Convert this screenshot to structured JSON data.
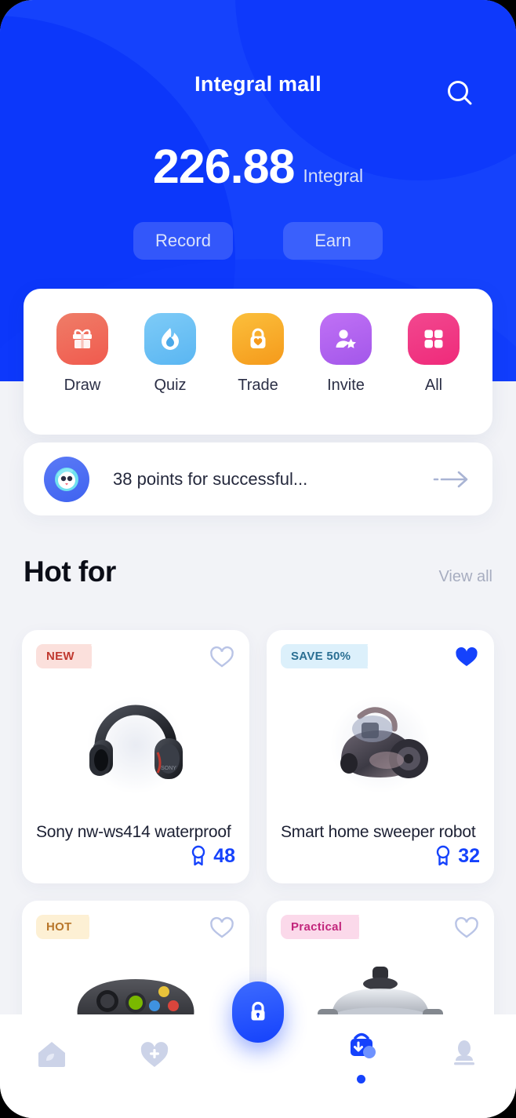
{
  "header": {
    "title": "Integral mall",
    "search_icon": "search-icon"
  },
  "balance": {
    "amount": "226.88",
    "unit": "Integral",
    "record_label": "Record",
    "earn_label": "Earn"
  },
  "quick_actions": [
    {
      "label": "Draw",
      "icon": "gift-icon",
      "color": "#f05a4e",
      "color2": "#ef7d68"
    },
    {
      "label": "Quiz",
      "icon": "flame-icon",
      "color": "#5ab6f2",
      "color2": "#7ecbf7"
    },
    {
      "label": "Trade",
      "icon": "lock-heart-icon",
      "color": "#f59a1b",
      "color2": "#fbbf3c"
    },
    {
      "label": "Invite",
      "icon": "user-star-icon",
      "color": "#a357ea",
      "color2": "#c071f5"
    },
    {
      "label": "All",
      "icon": "grid-squares-icon",
      "color": "#ef2a7a",
      "color2": "#f2488f"
    }
  ],
  "banner": {
    "avatar_icon": "mascot-avatar-icon",
    "text": "38 points for successful...",
    "arrow_icon": "arrow-right-icon"
  },
  "section": {
    "title": "Hot for",
    "view_all": "View all"
  },
  "products": [
    {
      "badge": "NEW",
      "badge_bg": "#fbe0dc",
      "badge_fg": "#c0392f",
      "name": "Sony nw-ws414 waterproof",
      "points": "48",
      "favorited": false,
      "image_icon": "headphones-image"
    },
    {
      "badge": "SAVE 50%",
      "badge_bg": "#dcf0fb",
      "badge_fg": "#2a6f93",
      "name": "Smart home sweeper robot",
      "points": "32",
      "favorited": true,
      "image_icon": "vacuum-cleaner-image"
    },
    {
      "badge": "HOT",
      "badge_bg": "#fdf0d4",
      "badge_fg": "#b8762a",
      "name": "",
      "points": "",
      "favorited": false,
      "image_icon": "game-controller-image"
    },
    {
      "badge": "Practical",
      "badge_bg": "#fbd9ea",
      "badge_fg": "#c2267c",
      "name": "",
      "points": "",
      "favorited": false,
      "image_icon": "cooking-pot-image"
    }
  ],
  "tabbar": {
    "items": [
      {
        "icon": "home-leaf-icon",
        "active": false
      },
      {
        "icon": "heart-plus-icon",
        "active": false
      },
      {
        "icon": "shopping-bag-icon",
        "active": true
      },
      {
        "icon": "stamp-icon",
        "active": false
      }
    ],
    "fab_icon": "lock-icon"
  },
  "colors": {
    "brand_blue": "#1542fc",
    "hero_blue_dark": "#0e39fb",
    "page_bg": "#f2f3f7",
    "inactive_nav": "#ccd3e8"
  }
}
